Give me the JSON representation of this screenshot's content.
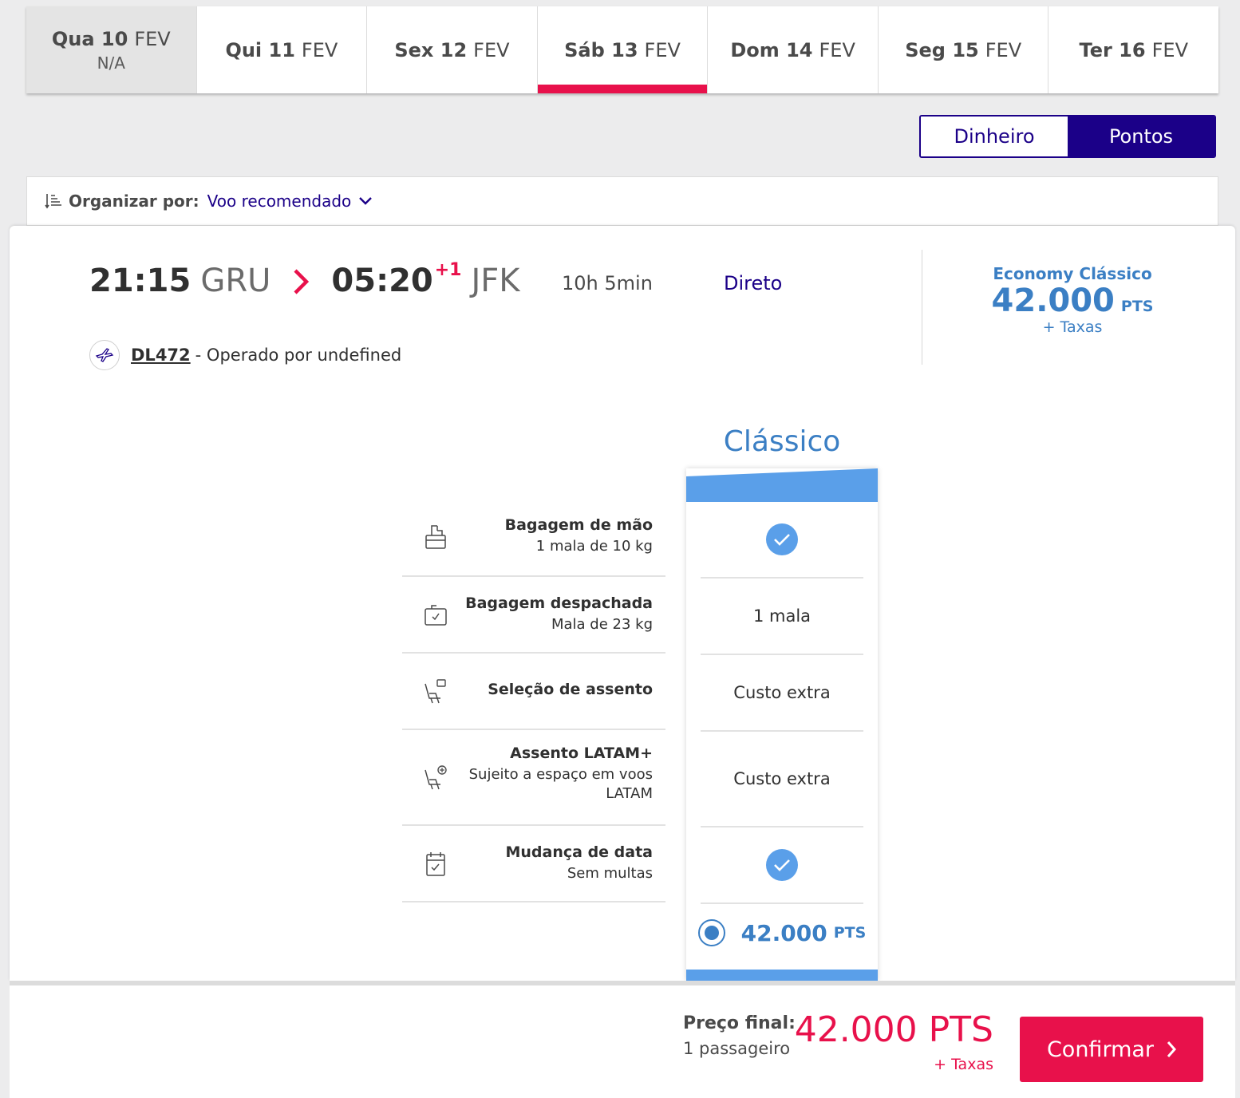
{
  "dates": [
    {
      "day": "Qua 10",
      "month": "FEV",
      "sub": "N/A"
    },
    {
      "day": "Qui 11",
      "month": "FEV",
      "sub": ""
    },
    {
      "day": "Sex 12",
      "month": "FEV",
      "sub": ""
    },
    {
      "day": "Sáb 13",
      "month": "FEV",
      "sub": ""
    },
    {
      "day": "Dom 14",
      "month": "FEV",
      "sub": ""
    },
    {
      "day": "Seg 15",
      "month": "FEV",
      "sub": ""
    },
    {
      "day": "Ter 16",
      "month": "FEV",
      "sub": ""
    }
  ],
  "currency": {
    "cash_label": "Dinheiro",
    "points_label": "Pontos",
    "selected": "Pontos"
  },
  "sort": {
    "label": "Organizar por:",
    "value": "Voo recomendado"
  },
  "flight": {
    "departure_time": "21:15",
    "departure_airport": "GRU",
    "arrival_time": "05:20",
    "arrival_day_offset": "+1",
    "arrival_airport": "JFK",
    "duration": "10h 5min",
    "stops": "Direto",
    "flight_number": "DL472",
    "operated_by": "- Operado por undefined",
    "fare_name": "Economy Clássico",
    "fare_amount": "42.000",
    "fare_unit": "PTS",
    "fare_taxes": "+ Taxas"
  },
  "fare": {
    "title": "Clássico",
    "price_amount": "42.000",
    "price_unit": "PTS"
  },
  "benefits": [
    {
      "title": "Bagagem de mão",
      "desc": "1 mala de 10 kg",
      "icon": "carry-on-bag-icon",
      "value": "",
      "included": true
    },
    {
      "title": "Bagagem despachada",
      "desc": "Mala de 23 kg",
      "icon": "checked-bag-icon",
      "value": "1 mala",
      "included": false
    },
    {
      "title": "Seleção de assento",
      "desc": "",
      "icon": "seat-icon",
      "value": "Custo extra",
      "included": false
    },
    {
      "title": "Assento LATAM+",
      "desc": "Sujeito a espaço em voos LATAM",
      "icon": "seat-plus-icon",
      "value": "Custo extra",
      "included": false
    },
    {
      "title": "Mudança de data",
      "desc": "Sem multas",
      "icon": "calendar-icon",
      "value": "",
      "included": true
    }
  ],
  "footer": {
    "final_label": "Preço final:",
    "passengers": "1 passageiro",
    "price": "42.000 PTS",
    "taxes": "+ Taxas",
    "confirm_label": "Confirmar"
  },
  "colors": {
    "brand_red": "#e8114b",
    "brand_navy": "#1b0088",
    "fare_blue": "#3b7fc4",
    "fare_light_blue": "#5a9fe9"
  }
}
